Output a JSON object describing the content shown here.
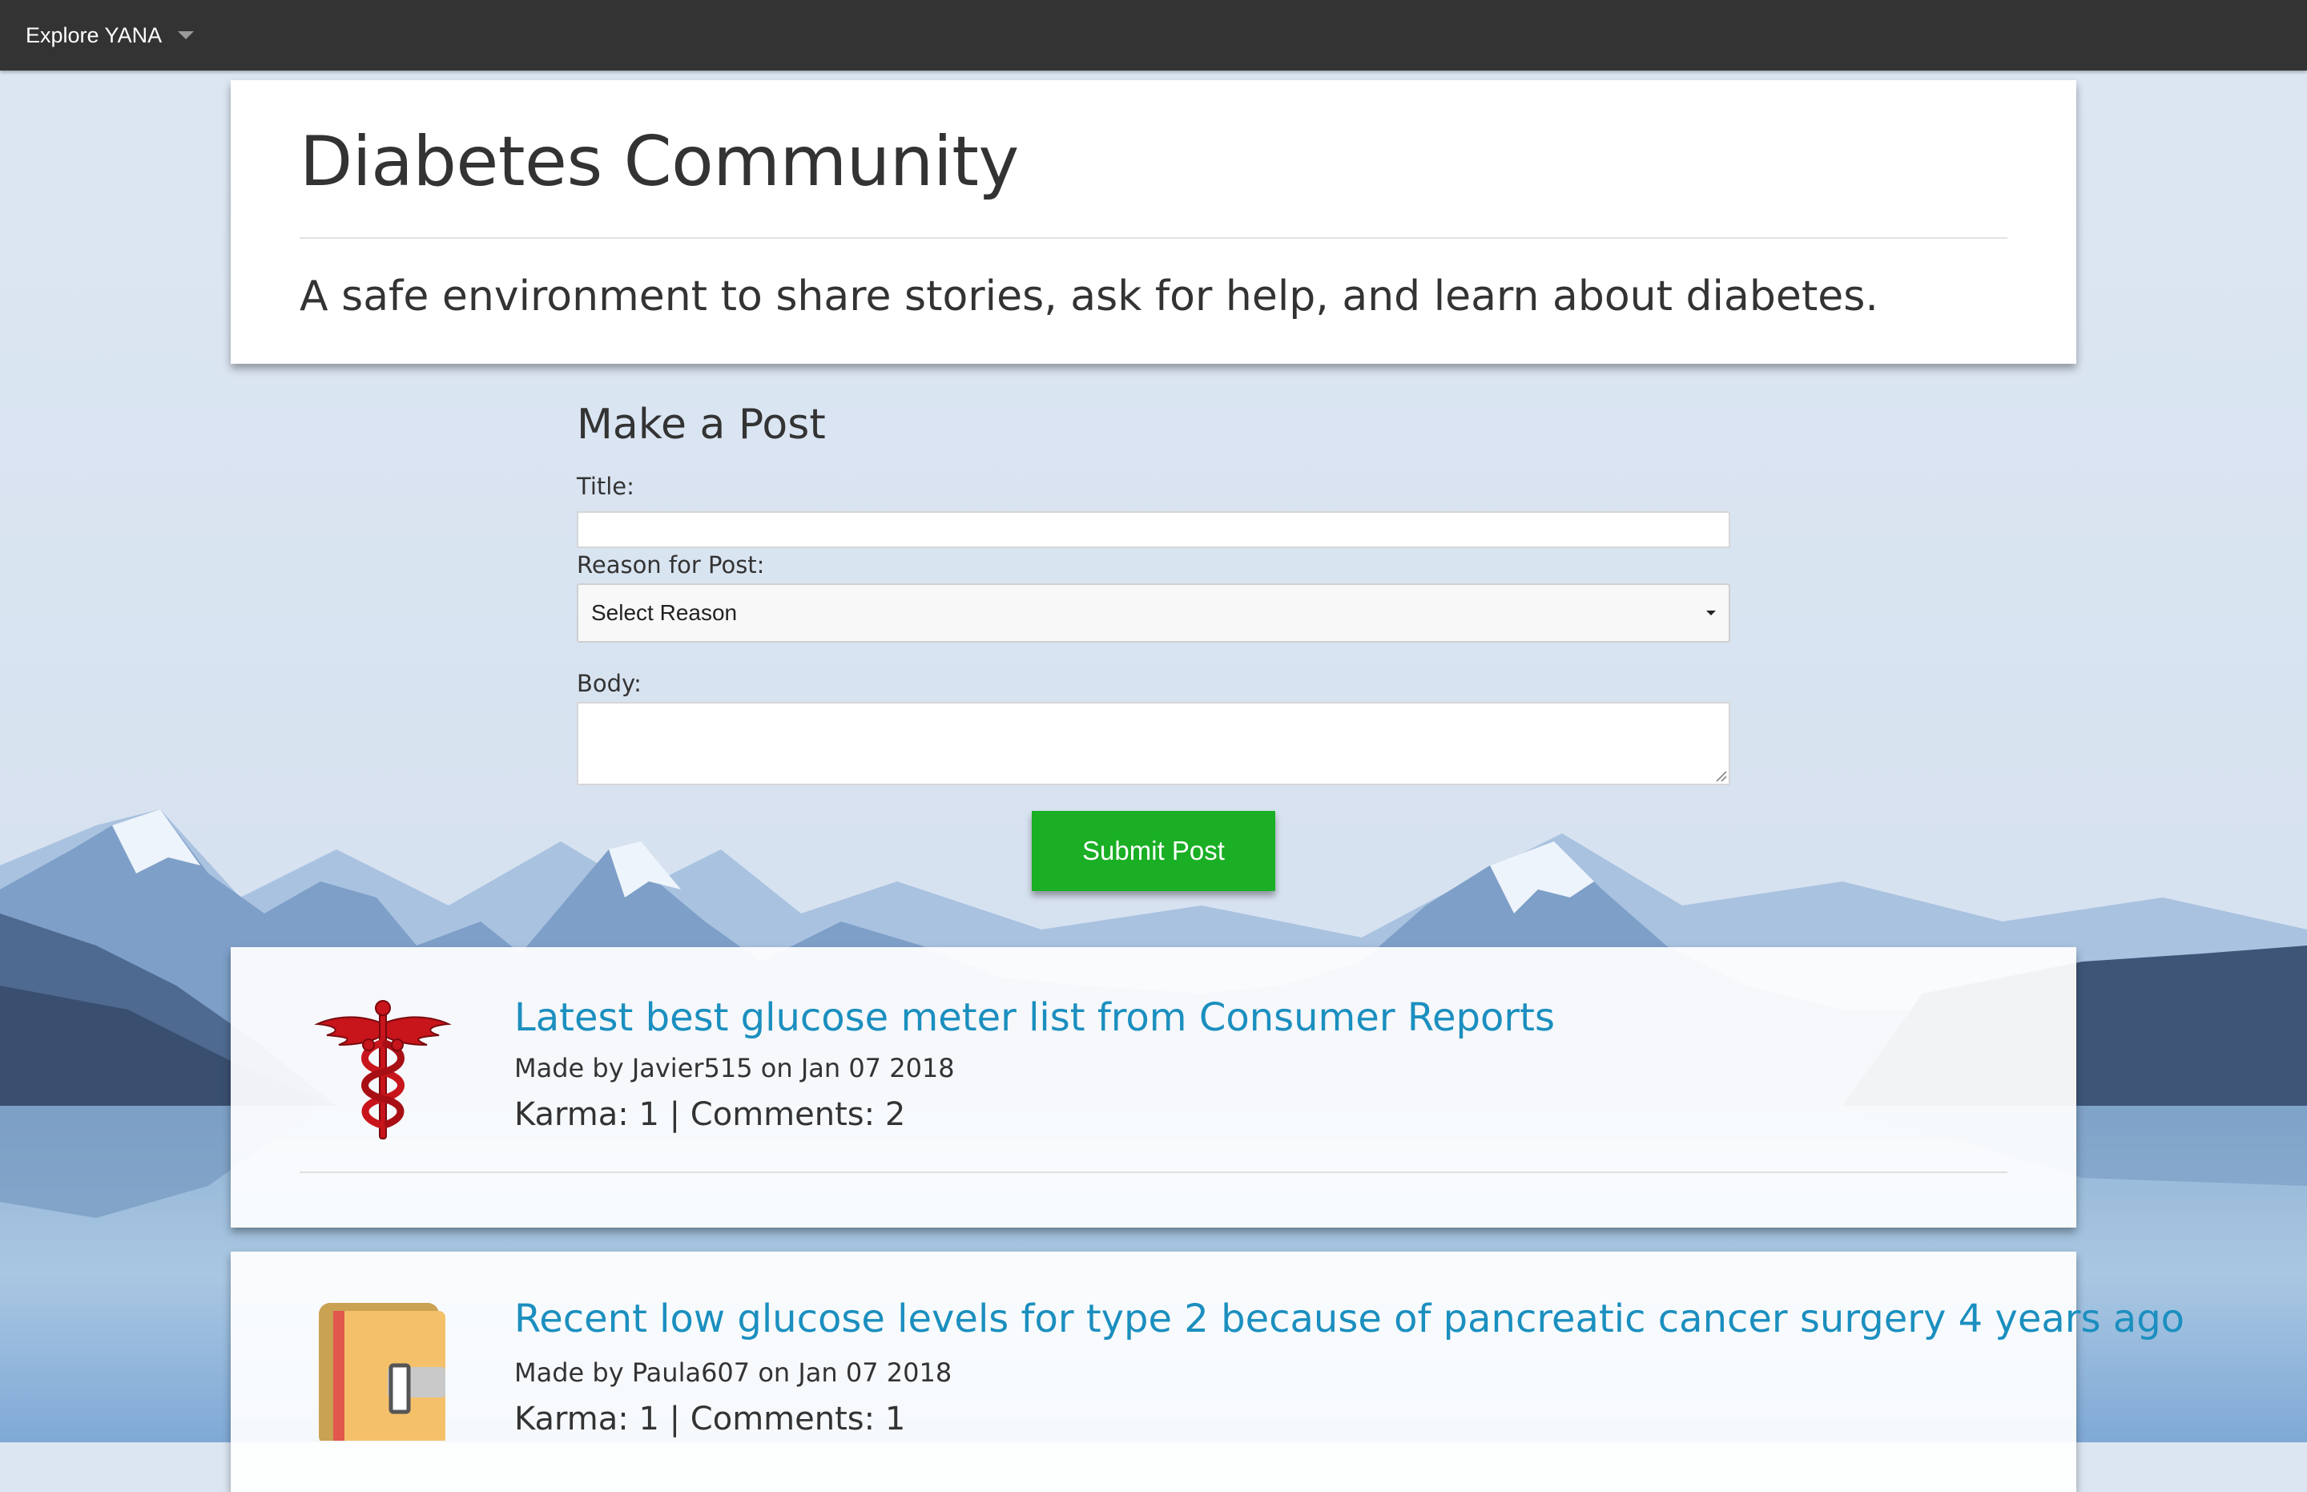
{
  "navbar": {
    "brand": "Explore YANA"
  },
  "header": {
    "title": "Diabetes Community",
    "subtitle": "A safe environment to share stories, ask for help, and learn about diabetes."
  },
  "form": {
    "heading": "Make a Post",
    "title_label": "Title:",
    "title_value": "",
    "reason_label": "Reason for Post:",
    "reason_selected": "Select Reason",
    "body_label": "Body:",
    "body_value": "",
    "submit_label": "Submit Post"
  },
  "posts": [
    {
      "icon": "caduceus-icon",
      "title": "Latest best glucose meter list from Consumer Reports",
      "meta": "Made by Javier515 on Jan 07 2018",
      "stats": "Karma: 1 | Comments: 2"
    },
    {
      "icon": "book-icon",
      "title": "Recent low glucose levels for type 2 because of pancreatic cancer surgery 4 years ago",
      "meta": "Made by Paula607 on Jan 07 2018",
      "stats": "Karma: 1 | Comments: 1"
    }
  ],
  "colors": {
    "navbar": "#333333",
    "accent_link": "#1b8fbf",
    "submit_button": "#1aaf24",
    "icon_red": "#c8141b"
  }
}
